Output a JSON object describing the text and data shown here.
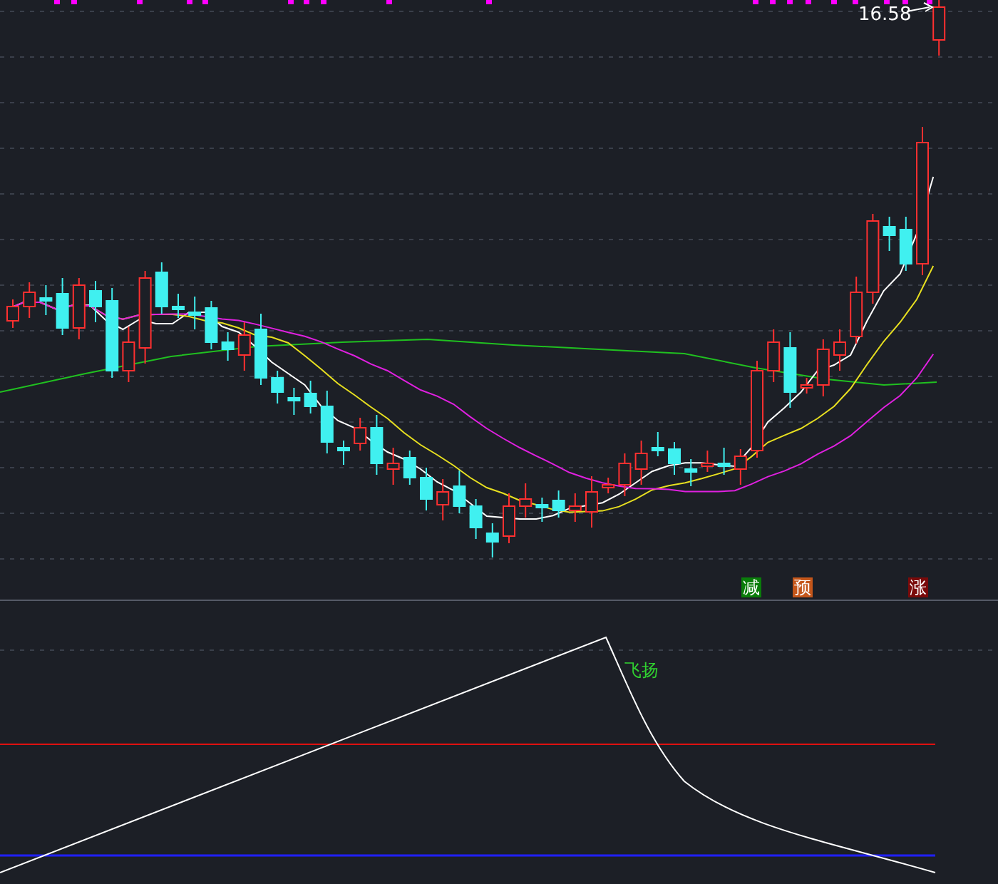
{
  "price_label": "16.58",
  "signals": [
    {
      "label": "减",
      "color": "#0a7d0a"
    },
    {
      "label": "预",
      "color": "#c4561a"
    },
    {
      "label": "涨",
      "color": "#7a0a0a"
    }
  ],
  "indicator": {
    "label": "飞扬"
  }
}
